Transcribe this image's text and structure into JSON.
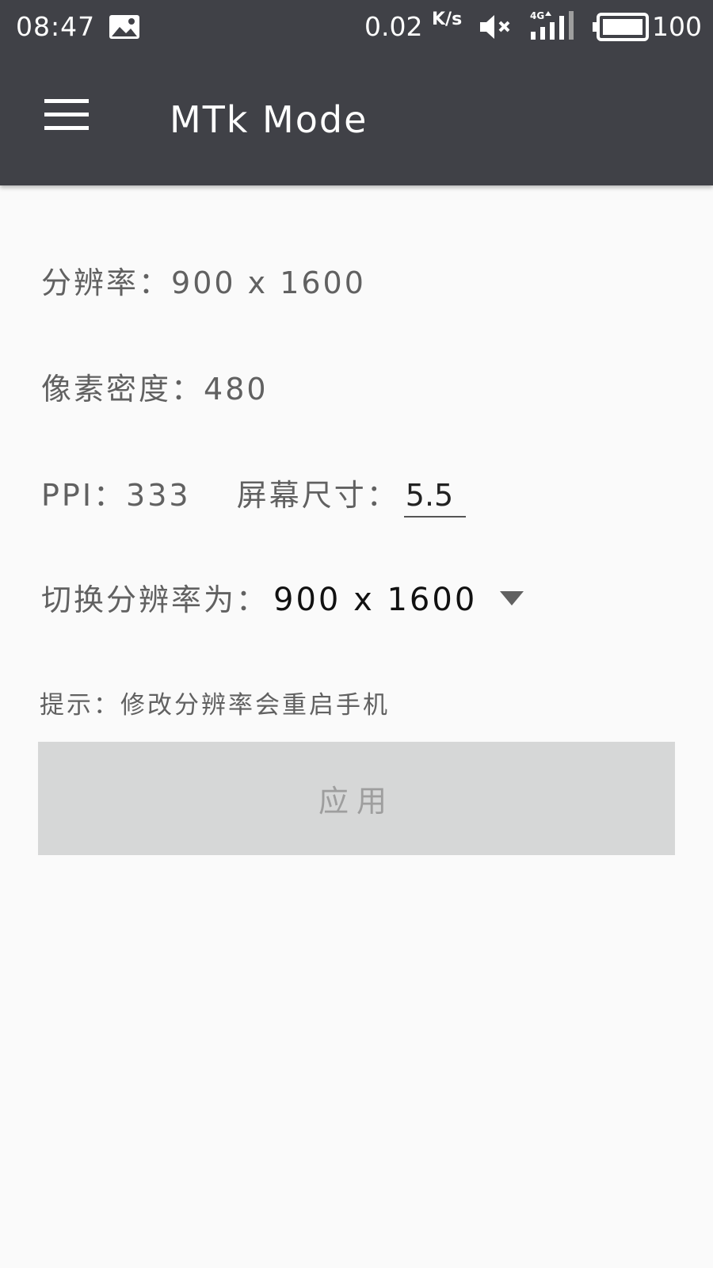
{
  "status_bar": {
    "time": "08:47",
    "speed_value": "0.02",
    "speed_unit": "K/s",
    "network": "4G",
    "battery": "100",
    "icons": [
      "gallery-icon",
      "mute-icon",
      "signal-icon",
      "battery-icon"
    ]
  },
  "app_bar": {
    "title": "MTk Mode",
    "menu_icon": "hamburger-menu-icon"
  },
  "info": {
    "resolution_label": "分辨率：",
    "resolution_value": "900 x 1600",
    "density_label": "像素密度：",
    "density_value": "480",
    "ppi_label": "PPI：",
    "ppi_value": "333",
    "screen_size_label": "屏幕尺寸：",
    "screen_size_value": "5.5"
  },
  "switch": {
    "label": "切换分辨率为：",
    "selected": "900 x 1600"
  },
  "hint": "提示：修改分辨率会重启手机",
  "apply_button": "应用",
  "colors": {
    "toolbar": "#404147",
    "background": "#fafafa",
    "text_secondary": "#616161",
    "button_disabled": "#d6d7d7"
  }
}
